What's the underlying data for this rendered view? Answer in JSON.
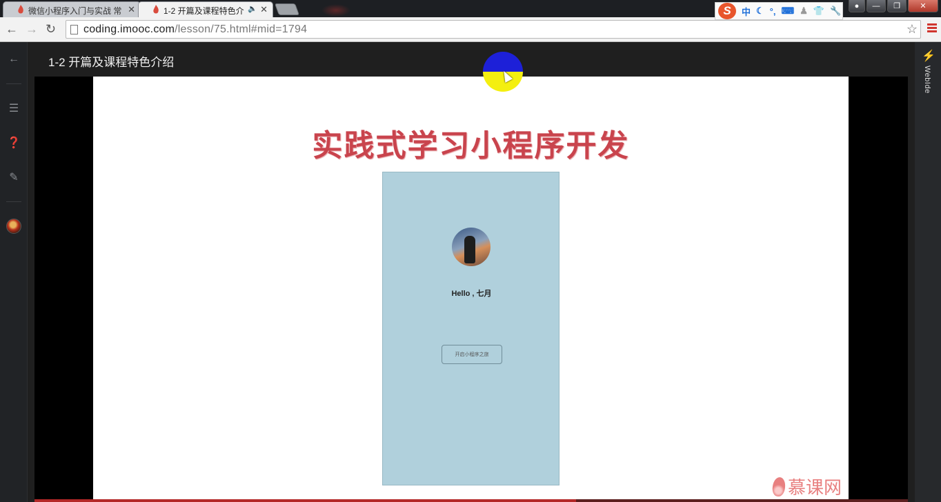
{
  "browser": {
    "tabs": [
      {
        "title": "微信小程序入门与实战 常",
        "active": false
      },
      {
        "title": "1-2 开篇及课程特色介",
        "active": true
      }
    ],
    "address": {
      "domain": "coding.imooc.com",
      "path": "/lesson/75.html#mid=1794"
    },
    "ime": {
      "logo": "S",
      "mode": "中",
      "extra": "°,"
    }
  },
  "lesson": {
    "title": "1-2 开篇及课程特色介绍",
    "sidebar_right_label": "WebIde"
  },
  "slide": {
    "title": "实践式学习小程序开发",
    "phone": {
      "greeting": "Hello , 七月",
      "button": "开启小程序之旅"
    },
    "watermark": "慕课网"
  },
  "video": {
    "progress_fraction": 0.62
  },
  "colors": {
    "accent": "#c9444d",
    "phone_bg": "#b0d0dc",
    "progress": "#b42828"
  }
}
